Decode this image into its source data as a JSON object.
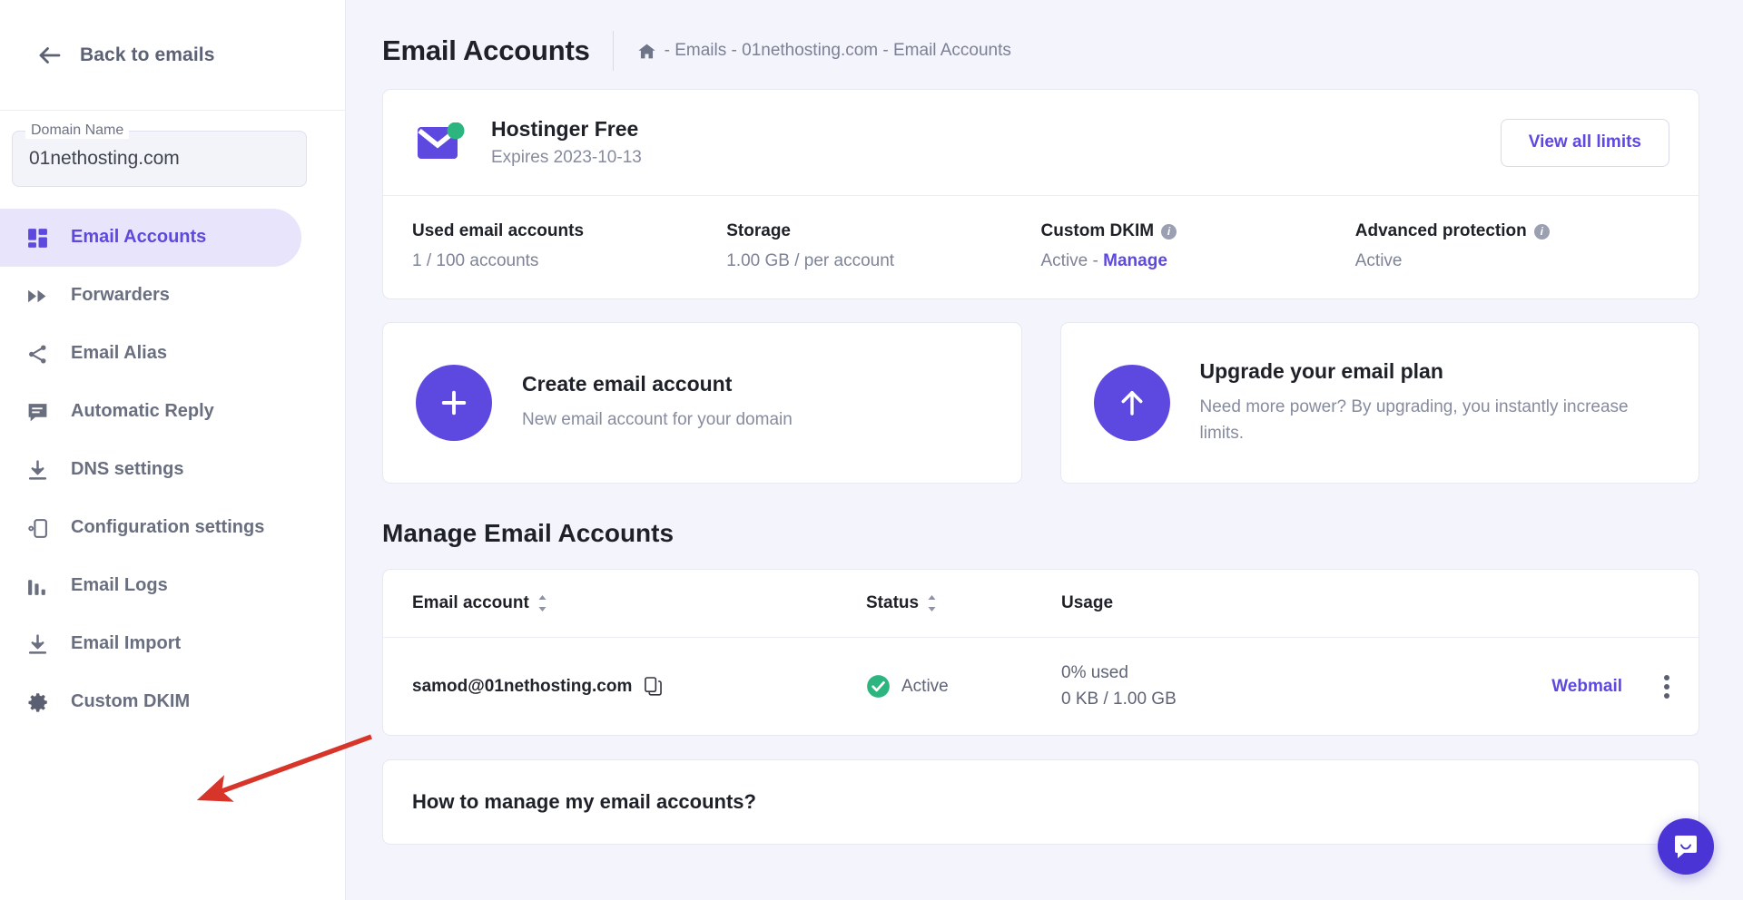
{
  "sidebar": {
    "back_label": "Back to emails",
    "back_icon": "arrow-left-icon",
    "domain_legend": "Domain Name",
    "domain_value": "01nethosting.com",
    "items": [
      {
        "label": "Email Accounts",
        "icon": "grid-icon",
        "active": true
      },
      {
        "label": "Forwarders",
        "icon": "fast-forward-icon",
        "active": false
      },
      {
        "label": "Email Alias",
        "icon": "share-icon",
        "active": false
      },
      {
        "label": "Automatic Reply",
        "icon": "chat-lines-icon",
        "active": false
      },
      {
        "label": "DNS settings",
        "icon": "download-icon",
        "active": false
      },
      {
        "label": "Configuration settings",
        "icon": "device-gear-icon",
        "active": false
      },
      {
        "label": "Email Logs",
        "icon": "bar-chart-icon",
        "active": false
      },
      {
        "label": "Email Import",
        "icon": "download-icon",
        "active": false
      },
      {
        "label": "Custom DKIM",
        "icon": "gear-icon",
        "active": false
      }
    ]
  },
  "header": {
    "title": "Email Accounts",
    "home_icon": "home-icon",
    "breadcrumb": "- Emails - 01nethosting.com - Email Accounts"
  },
  "plan": {
    "icon": "envelope-icon",
    "name": "Hostinger Free",
    "expires": "Expires 2023-10-13",
    "view_limits_label": "View all limits",
    "stats": [
      {
        "label": "Used email accounts",
        "value": "1 / 100 accounts",
        "info": false
      },
      {
        "label": "Storage",
        "value": "1.00 GB / per account",
        "info": false
      },
      {
        "label": "Custom DKIM",
        "value": "Active -",
        "link": "Manage",
        "info": true
      },
      {
        "label": "Advanced protection",
        "value": "Active",
        "info": true
      }
    ]
  },
  "actions": [
    {
      "icon": "plus-icon",
      "title": "Create email account",
      "desc": "New email account for your domain"
    },
    {
      "icon": "arrow-up-icon",
      "title": "Upgrade your email plan",
      "desc": "Need more power? By upgrading, you instantly increase limits."
    }
  ],
  "manage": {
    "section_title": "Manage Email Accounts",
    "columns": [
      {
        "label": "Email account",
        "sortable": true
      },
      {
        "label": "Status",
        "sortable": true
      },
      {
        "label": "Usage",
        "sortable": false
      }
    ],
    "rows": [
      {
        "email": "samod@01nethosting.com",
        "copy_icon": "copy-icon",
        "status": "Active",
        "status_icon": "check-circle-icon",
        "usage_percent": "0% used",
        "usage_size": "0 KB / 1.00 GB",
        "webmail_label": "Webmail",
        "menu_icon": "kebab-menu-icon"
      }
    ]
  },
  "faq": {
    "question": "How to manage my email accounts?"
  },
  "chat": {
    "icon": "chat-bubble-icon"
  },
  "colors": {
    "accent": "#5d49e0",
    "accent_soft": "#e7e4fb",
    "page_bg": "#f4f5fc",
    "success": "#2cb57f",
    "annotation_arrow": "#d8352a"
  },
  "annotation": {
    "type": "arrow",
    "points_to": "Email Import"
  }
}
